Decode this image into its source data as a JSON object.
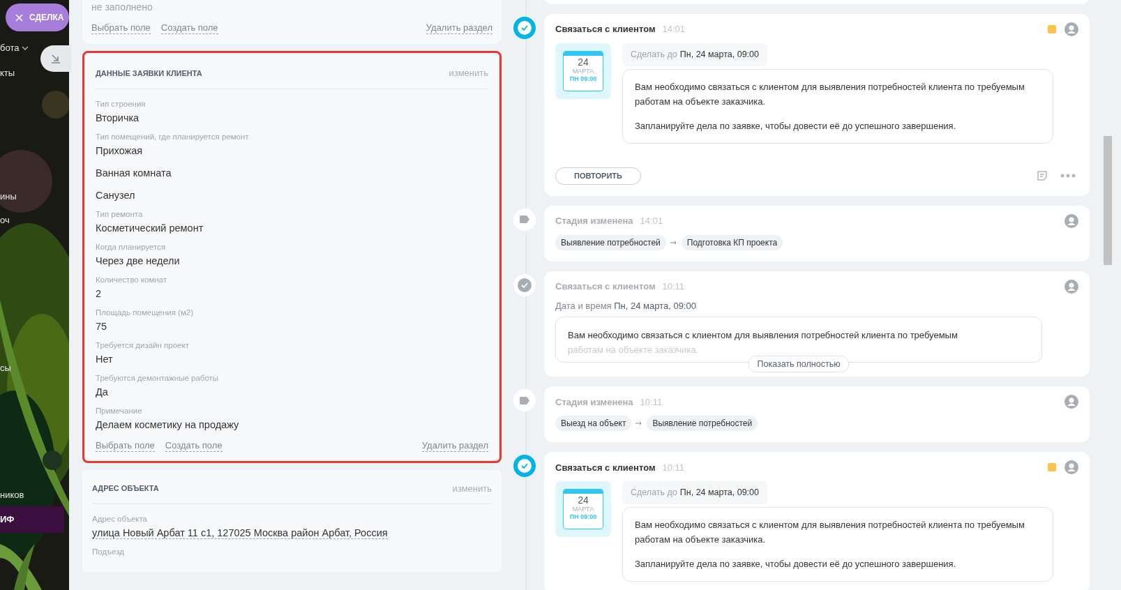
{
  "sidebar": {
    "deal_badge": "СДЕЛКА",
    "items": [
      {
        "label": "бота",
        "expandable": true,
        "selected": false
      },
      {
        "label": "кты",
        "expandable": false,
        "selected": false
      },
      {
        "label": "ины",
        "expandable": false,
        "selected": false
      },
      {
        "label": "оч",
        "expandable": false,
        "selected": false
      },
      {
        "label": "сы",
        "expandable": false,
        "selected": false
      },
      {
        "label": "ников",
        "expandable": false,
        "selected": false
      },
      {
        "label": "ИФ",
        "expandable": false,
        "selected": true
      }
    ]
  },
  "sections": [
    {
      "kind": "tail",
      "empty_text": "не заполнено",
      "links": [
        "Выбрать поле",
        "Создать поле"
      ],
      "delete_link": "Удалить раздел"
    },
    {
      "kind": "section",
      "title": "ДАННЫЕ ЗАЯВКИ КЛИЕНТА",
      "edit_link": "изменить",
      "highlighted": true,
      "fields": [
        {
          "label": "Тип строения",
          "values": [
            "Вторичка"
          ]
        },
        {
          "label": "Тип помещений, где планируется ремонт",
          "values": [
            "Прихожая",
            "Ванная комната",
            "Санузел"
          ]
        },
        {
          "label": "Тип ремонта",
          "values": [
            "Косметический ремонт"
          ]
        },
        {
          "label": "Когда планируется",
          "values": [
            "Через две недели"
          ]
        },
        {
          "label": "Количество комнат",
          "values": [
            "2"
          ]
        },
        {
          "label": "Площадь помещения (м2)",
          "values": [
            "75"
          ]
        },
        {
          "label": "Требуется дизайн проект",
          "values": [
            "Нет"
          ]
        },
        {
          "label": "Требуются демонтажные работы",
          "values": [
            "Да"
          ]
        },
        {
          "label": "Примечание",
          "values": [
            "Делаем косметику на продажу"
          ]
        }
      ],
      "links": [
        "Выбрать поле",
        "Создать поле"
      ],
      "delete_link": "Удалить раздел"
    },
    {
      "kind": "section",
      "title": "АДРЕС ОБЪЕКТА",
      "edit_link": "изменить",
      "highlighted": false,
      "fields": [
        {
          "label": "Адрес объекта",
          "values": [
            "улица Новый Арбат 11 с1, 127025 Москва район Арбат, Россия"
          ],
          "underlined": true
        },
        {
          "label": "Подъезд"
        }
      ]
    }
  ],
  "timeline": [
    {
      "kind": "task",
      "active": true,
      "title": "Связаться с клиентом",
      "time": "14:01",
      "calendar": {
        "day": "24",
        "month": "МАРТА",
        "weekday_time": "ПН 09:00"
      },
      "deadline_label": "Сделать до",
      "deadline": "Пн, 24 марта, 09:00",
      "paragraphs": [
        "Вам необходимо связаться с клиентом для выявления потребностей клиента по требуемым работам на объекте заказчика.",
        "Запланируйте дела по заявке, чтобы довести её до успешного завершения."
      ],
      "button": "ПОВТОРИТЬ"
    },
    {
      "kind": "stage",
      "title": "Стадия изменена",
      "time": "14:01",
      "from": "Выявление потребностей",
      "to": "Подготовка КП проекта"
    },
    {
      "kind": "done",
      "title": "Связаться с клиентом",
      "time": "10:11",
      "date_label": "Дата и время",
      "date": "Пн, 24 марта, 09:00",
      "text": "Вам необходимо связаться с клиентом для выявления потребностей клиента по требуемым",
      "faded_text": "работам на объекте заказчика.",
      "button": "Показать полностью"
    },
    {
      "kind": "stage",
      "title": "Стадия изменена",
      "time": "10:11",
      "from": "Выезд на объект",
      "to": "Выявление потребностей"
    },
    {
      "kind": "task",
      "active": true,
      "title": "Связаться с клиентом",
      "time": "10:11",
      "calendar": {
        "day": "24",
        "month": "МАРТА",
        "weekday_time": "ПН 09:00"
      },
      "deadline_label": "Сделать до",
      "deadline": "Пн, 24 марта, 09:00",
      "paragraphs": [
        "Вам необходимо связаться с клиентом для выявления потребностей клиента по требуемым работам на объекте заказчика.",
        "Запланируйте дела по заявке, чтобы довести её до успешного завершения."
      ]
    }
  ]
}
